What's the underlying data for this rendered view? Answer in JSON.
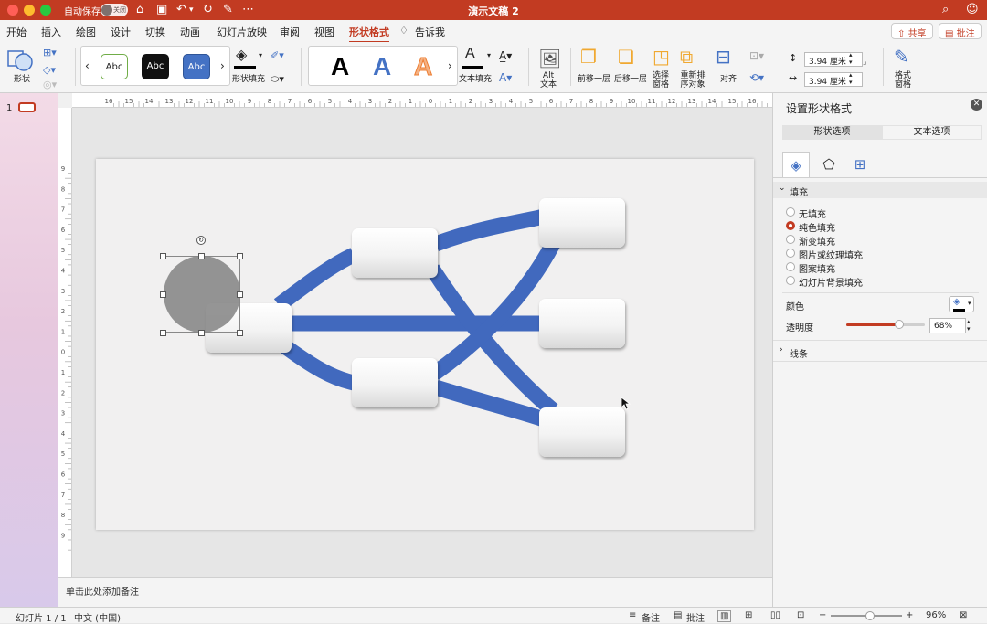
{
  "titlebar": {
    "autosave": "自动保存",
    "toggle": "关闭",
    "document_title": "演示文稿 2"
  },
  "menu": {
    "items": [
      "开始",
      "插入",
      "绘图",
      "设计",
      "切换",
      "动画",
      "幻灯片放映",
      "审阅",
      "视图",
      "形状格式"
    ],
    "tell_me": "告诉我",
    "share": "共享",
    "comments": "批注"
  },
  "ribbon": {
    "shapes_label": "形状",
    "style_gallery": [
      "Abc",
      "Abc",
      "Abc"
    ],
    "shape_fill_label": "形状填充",
    "wordart_letters": [
      "A",
      "A",
      "A"
    ],
    "text_fill_label": "文本填充",
    "alt_text_label": "Alt\n文本",
    "bring_forward_label": "前移一层",
    "send_backward_label": "后移一层",
    "selection_pane_label": "选择\n窗格",
    "reorder_label": "重新排\n序对象",
    "align_label": "对齐",
    "height_value": "3.94 厘米",
    "width_value": "3.94 厘米",
    "format_pane_label": "格式\n窗格",
    "colors": {
      "accent": "#c23b22",
      "blue_style": "#4472c4"
    }
  },
  "thumbnails": {
    "slide_number": "1"
  },
  "rulers": {
    "h_ticks": [
      "16",
      "15",
      "14",
      "13",
      "12",
      "11",
      "10",
      "9",
      "8",
      "7",
      "6",
      "5",
      "4",
      "3",
      "2",
      "1",
      "0",
      "1",
      "2",
      "3",
      "4",
      "5",
      "6",
      "7",
      "8",
      "9",
      "10",
      "11",
      "12",
      "13",
      "14",
      "15",
      "16"
    ],
    "v_ticks": [
      "9",
      "8",
      "7",
      "6",
      "5",
      "4",
      "3",
      "2",
      "1",
      "0",
      "1",
      "2",
      "3",
      "4",
      "5",
      "6",
      "7",
      "8",
      "9"
    ]
  },
  "notes": {
    "placeholder": "单击此处添加备注"
  },
  "format_panel": {
    "title": "设置形状格式",
    "tabs": [
      "形状选项",
      "文本选项"
    ],
    "fill_section": "填充",
    "fill_options": [
      "无填充",
      "纯色填充",
      "渐变填充",
      "图片或纹理填充",
      "图案填充",
      "幻灯片背景填充"
    ],
    "selected_fill": "纯色填充",
    "color_label": "颜色",
    "transparency_label": "透明度",
    "transparency_value": "68%",
    "transparency_fraction": 0.68,
    "line_section": "线条"
  },
  "status": {
    "slide_info": "幻灯片 1 / 1",
    "language": "中文 (中国)",
    "notes_btn": "备注",
    "comments_btn": "批注",
    "zoom": "96%",
    "zoom_fraction": 0.55
  }
}
